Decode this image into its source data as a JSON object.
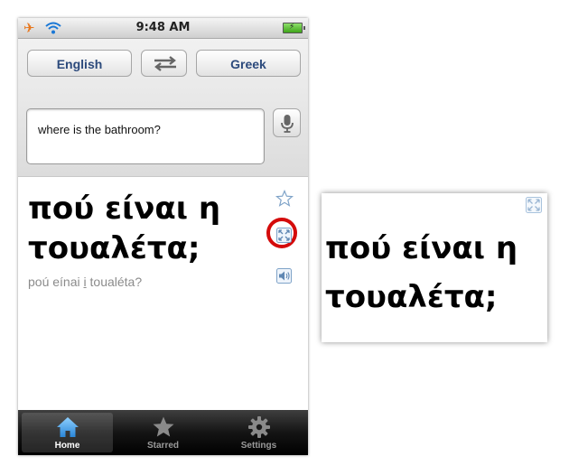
{
  "status_bar": {
    "time": "9:48 AM",
    "icons": [
      "airplane-icon",
      "wifi-icon",
      "battery-charging-icon"
    ]
  },
  "languages": {
    "source": "English",
    "target": "Greek",
    "swap_icon": "swap-arrows-icon"
  },
  "input": {
    "value": "where is the bathroom?",
    "mic_icon": "microphone-icon"
  },
  "result": {
    "translation_line1": "πού είναι η",
    "translation_line2": "τουαλέτα;",
    "transliteration_before": "poú eínai ",
    "transliteration_underlined": "i",
    "transliteration_after": " toualéta?",
    "action_icons": [
      "star-icon",
      "fullscreen-icon",
      "speaker-icon"
    ],
    "highlight_color": "#d40b0b"
  },
  "tabs": [
    {
      "label": "Home",
      "icon": "home-icon",
      "active": true
    },
    {
      "label": "Starred",
      "icon": "star-icon",
      "active": false
    },
    {
      "label": "Settings",
      "icon": "gear-icon",
      "active": false
    }
  ],
  "fullscreen_card": {
    "line1": "πού είναι η",
    "line2": "τουαλέτα;",
    "icon": "fullscreen-icon"
  },
  "colors": {
    "lang_text": "#2c4a7c",
    "home_icon": "#3a9ee8",
    "tabbar": "#141414"
  }
}
